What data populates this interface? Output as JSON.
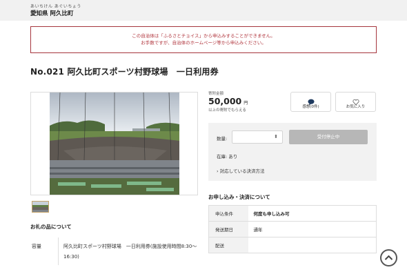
{
  "header": {
    "furigana": "あいちけん あぐいちょう",
    "municipality": "愛知県 阿久比町"
  },
  "notice": {
    "line1": "この自治体は「ふるさとチョイス」から申込みすることができません。",
    "line2": "お手数ですが、自治体のホームページ等から申込みください。"
  },
  "product": {
    "title": "No.021 阿久比町スポーツ村野球場　一日利用券"
  },
  "donation": {
    "label": "寄附金額",
    "amount": "50,000",
    "unit": "円",
    "note": "以上の寄附でもらえる"
  },
  "actions": {
    "impression_label": "感想(0件)",
    "favorite_label": "お気に入り"
  },
  "purchase": {
    "qty_label": "数量:",
    "qty_value": "",
    "stop_label": "受付停止中",
    "stock_text": "在庫: あり",
    "payment_link": "› 対応している決済方法"
  },
  "item_info": {
    "heading": "お礼の品について",
    "spec_label": "容量",
    "spec_value": "阿久比町スポーツ村野球場　一日利用券(施設使用時間8:30～16:30)"
  },
  "application": {
    "heading": "お申し込み・決済について",
    "rows": [
      {
        "key": "申込条件",
        "value": "何度も申し込み可"
      },
      {
        "key": "発送期日",
        "value": "通年"
      },
      {
        "key": "配送",
        "value": ""
      }
    ]
  },
  "colors": {
    "notice_border": "#a5343c",
    "notice_text": "#b0343c",
    "disabled_button": "#b7b7b7",
    "impression_icon": "#1f3a5f"
  }
}
